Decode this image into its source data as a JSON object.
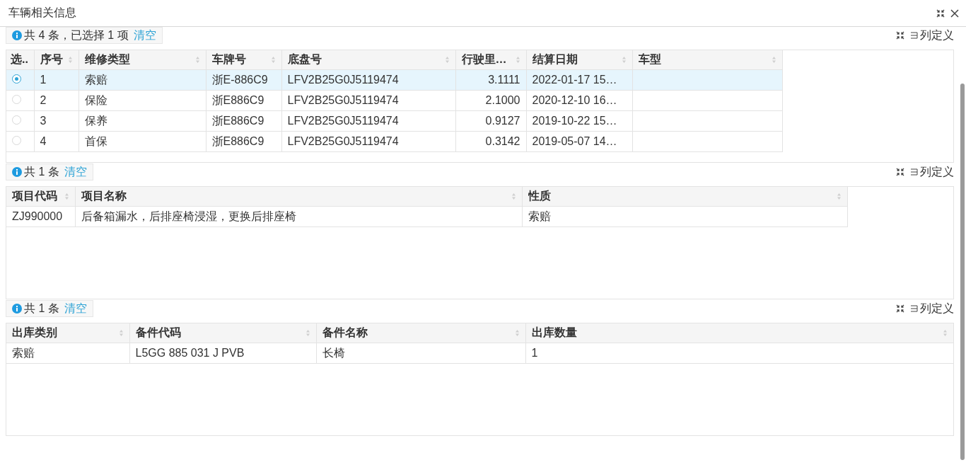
{
  "window": {
    "title": "车辆相关信息"
  },
  "panels": [
    {
      "summary": "共 4 条，已选择 1 项",
      "clear_link": "清空",
      "column_settings": "列定义",
      "columns": [
        {
          "label": "选..",
          "kind": "radio"
        },
        {
          "label": "序号",
          "kind": "text"
        },
        {
          "label": "维修类型",
          "kind": "text"
        },
        {
          "label": "车牌号",
          "kind": "text"
        },
        {
          "label": "底盘号",
          "kind": "text"
        },
        {
          "label": "行驶里…",
          "kind": "number"
        },
        {
          "label": "结算日期",
          "kind": "text"
        },
        {
          "label": "车型",
          "kind": "text"
        }
      ],
      "rows": [
        {
          "selected": true,
          "cells": [
            "",
            "1",
            "索赔",
            "浙E-886C9",
            "LFV2B25G0J5119474",
            "3.1111",
            "2022-01-17 15…",
            ""
          ]
        },
        {
          "selected": false,
          "cells": [
            "",
            "2",
            "保险",
            "浙E886C9",
            "LFV2B25G0J5119474",
            "2.1000",
            "2020-12-10 16…",
            ""
          ]
        },
        {
          "selected": false,
          "cells": [
            "",
            "3",
            "保养",
            "浙E886C9",
            "LFV2B25G0J5119474",
            "0.9127",
            "2019-10-22 15…",
            ""
          ]
        },
        {
          "selected": false,
          "cells": [
            "",
            "4",
            "首保",
            "浙E886C9",
            "LFV2B25G0J5119474",
            "0.3142",
            "2019-05-07 14…",
            ""
          ]
        }
      ]
    },
    {
      "summary": "共 1 条",
      "clear_link": "清空",
      "column_settings": "列定义",
      "columns": [
        {
          "label": "项目代码",
          "kind": "text"
        },
        {
          "label": "项目名称",
          "kind": "text"
        },
        {
          "label": "性质",
          "kind": "text"
        }
      ],
      "rows": [
        {
          "cells": [
            "ZJ990000",
            "后备箱漏水，后排座椅浸湿，更换后排座椅",
            "索赔"
          ]
        }
      ]
    },
    {
      "summary": "共 1 条",
      "clear_link": "清空",
      "column_settings": "列定义",
      "columns": [
        {
          "label": "出库类别",
          "kind": "text"
        },
        {
          "label": "备件代码",
          "kind": "text"
        },
        {
          "label": "备件名称",
          "kind": "text"
        },
        {
          "label": "出库数量",
          "kind": "text"
        }
      ],
      "rows": [
        {
          "cells": [
            "索赔",
            "L5GG 885 031 J PVB",
            "长椅",
            "1"
          ]
        }
      ]
    }
  ]
}
